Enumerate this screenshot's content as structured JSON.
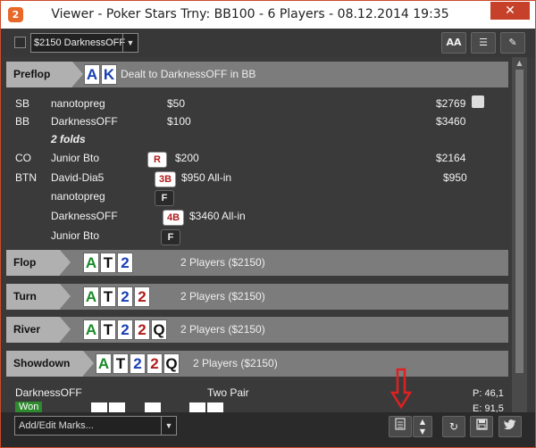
{
  "window": {
    "title": "Viewer - Poker Stars Trny: BB100 - 6 Players - 08.12.2014 19:35",
    "app_icon": "2",
    "close": "✕"
  },
  "toolbar": {
    "pot_select": "$2150 DarknessOFF",
    "font_btn": "AA",
    "list_btn": "☰",
    "edit_btn": "✎"
  },
  "preflop": {
    "label": "Preflop",
    "cards": [
      "A",
      "K"
    ],
    "text": "Dealt to DarknessOFF in BB"
  },
  "rows": [
    {
      "pos": "SB",
      "player": "nanotopreg",
      "action": "",
      "amount": "$50",
      "stack": "$2769"
    },
    {
      "pos": "BB",
      "player": "DarknessOFF",
      "action": "",
      "amount": "$100",
      "stack": "$3460"
    },
    {
      "pos": "",
      "player": "2 folds",
      "action": "",
      "amount": "",
      "stack": ""
    },
    {
      "pos": "CO",
      "player": "Junior Bto",
      "action": "R",
      "amount": "$200",
      "stack": "$2164"
    },
    {
      "pos": "BTN",
      "player": "David-Dia5",
      "action": "3B",
      "amount": "$950 All-in",
      "stack": "$950"
    },
    {
      "pos": "",
      "player": "nanotopreg",
      "action": "F",
      "amount": "",
      "stack": ""
    },
    {
      "pos": "",
      "player": "DarknessOFF",
      "action": "4B",
      "amount": "$3460 All-in",
      "stack": ""
    },
    {
      "pos": "",
      "player": "Junior Bto",
      "action": "F",
      "amount": "",
      "stack": ""
    }
  ],
  "flop": {
    "label": "Flop",
    "cards": [
      "A",
      "T",
      "2"
    ],
    "text": "2 Players ($2150)"
  },
  "turn": {
    "label": "Turn",
    "cards": [
      "A",
      "T",
      "2",
      "2"
    ],
    "text": "2 Players ($2150)"
  },
  "river": {
    "label": "River",
    "cards": [
      "A",
      "T",
      "2",
      "2",
      "Q"
    ],
    "text": "2 Players ($2150)"
  },
  "showdown": {
    "label": "Showdown",
    "cards": [
      "A",
      "T",
      "2",
      "2",
      "Q"
    ],
    "text": "2 Players ($2150)",
    "player": "DarknessOFF",
    "hand": "Two Pair",
    "won": "Won",
    "p": "P: 46,1",
    "e": "E: 91,5"
  },
  "bottom": {
    "marks": "Add/Edit Marks...",
    "notes_icon": "notes-icon",
    "reload": "↻",
    "save": "💾",
    "twitter": "twitter-icon"
  },
  "colors": {
    "accent": "#cc4a2a",
    "spade": "#111111",
    "heart": "#b01c1c",
    "diamond": "#1a3fb5",
    "club": "#1b8a2a"
  }
}
